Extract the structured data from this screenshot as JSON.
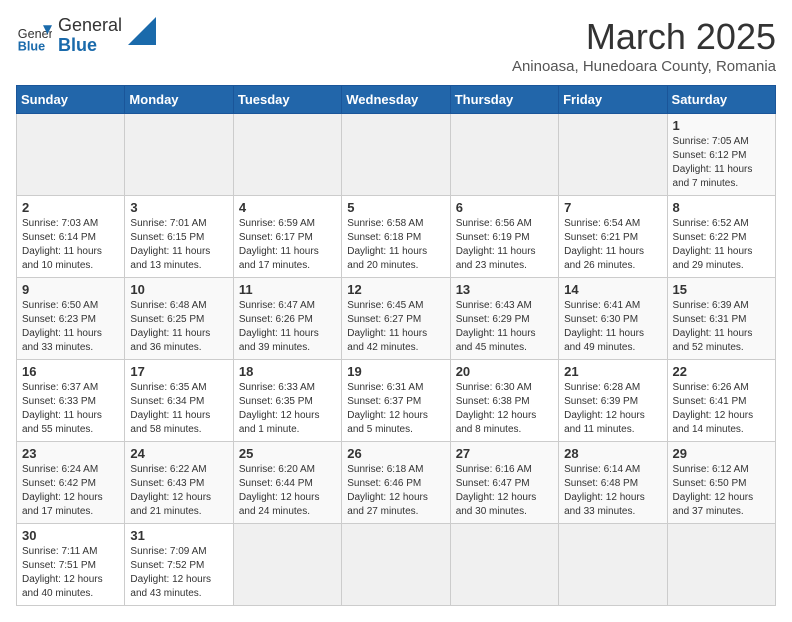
{
  "header": {
    "logo_general": "General",
    "logo_blue": "Blue",
    "month_title": "March 2025",
    "location": "Aninoasa, Hunedoara County, Romania"
  },
  "weekdays": [
    "Sunday",
    "Monday",
    "Tuesday",
    "Wednesday",
    "Thursday",
    "Friday",
    "Saturday"
  ],
  "weeks": [
    [
      {
        "day": "",
        "info": ""
      },
      {
        "day": "",
        "info": ""
      },
      {
        "day": "",
        "info": ""
      },
      {
        "day": "",
        "info": ""
      },
      {
        "day": "",
        "info": ""
      },
      {
        "day": "",
        "info": ""
      },
      {
        "day": "1",
        "info": "Sunrise: 7:05 AM\nSunset: 6:12 PM\nDaylight: 11 hours\nand 7 minutes."
      }
    ],
    [
      {
        "day": "2",
        "info": "Sunrise: 7:03 AM\nSunset: 6:14 PM\nDaylight: 11 hours\nand 10 minutes."
      },
      {
        "day": "3",
        "info": "Sunrise: 7:01 AM\nSunset: 6:15 PM\nDaylight: 11 hours\nand 13 minutes."
      },
      {
        "day": "4",
        "info": "Sunrise: 6:59 AM\nSunset: 6:17 PM\nDaylight: 11 hours\nand 17 minutes."
      },
      {
        "day": "5",
        "info": "Sunrise: 6:58 AM\nSunset: 6:18 PM\nDaylight: 11 hours\nand 20 minutes."
      },
      {
        "day": "6",
        "info": "Sunrise: 6:56 AM\nSunset: 6:19 PM\nDaylight: 11 hours\nand 23 minutes."
      },
      {
        "day": "7",
        "info": "Sunrise: 6:54 AM\nSunset: 6:21 PM\nDaylight: 11 hours\nand 26 minutes."
      },
      {
        "day": "8",
        "info": "Sunrise: 6:52 AM\nSunset: 6:22 PM\nDaylight: 11 hours\nand 29 minutes."
      }
    ],
    [
      {
        "day": "9",
        "info": "Sunrise: 6:50 AM\nSunset: 6:23 PM\nDaylight: 11 hours\nand 33 minutes."
      },
      {
        "day": "10",
        "info": "Sunrise: 6:48 AM\nSunset: 6:25 PM\nDaylight: 11 hours\nand 36 minutes."
      },
      {
        "day": "11",
        "info": "Sunrise: 6:47 AM\nSunset: 6:26 PM\nDaylight: 11 hours\nand 39 minutes."
      },
      {
        "day": "12",
        "info": "Sunrise: 6:45 AM\nSunset: 6:27 PM\nDaylight: 11 hours\nand 42 minutes."
      },
      {
        "day": "13",
        "info": "Sunrise: 6:43 AM\nSunset: 6:29 PM\nDaylight: 11 hours\nand 45 minutes."
      },
      {
        "day": "14",
        "info": "Sunrise: 6:41 AM\nSunset: 6:30 PM\nDaylight: 11 hours\nand 49 minutes."
      },
      {
        "day": "15",
        "info": "Sunrise: 6:39 AM\nSunset: 6:31 PM\nDaylight: 11 hours\nand 52 minutes."
      }
    ],
    [
      {
        "day": "16",
        "info": "Sunrise: 6:37 AM\nSunset: 6:33 PM\nDaylight: 11 hours\nand 55 minutes."
      },
      {
        "day": "17",
        "info": "Sunrise: 6:35 AM\nSunset: 6:34 PM\nDaylight: 11 hours\nand 58 minutes."
      },
      {
        "day": "18",
        "info": "Sunrise: 6:33 AM\nSunset: 6:35 PM\nDaylight: 12 hours\nand 1 minute."
      },
      {
        "day": "19",
        "info": "Sunrise: 6:31 AM\nSunset: 6:37 PM\nDaylight: 12 hours\nand 5 minutes."
      },
      {
        "day": "20",
        "info": "Sunrise: 6:30 AM\nSunset: 6:38 PM\nDaylight: 12 hours\nand 8 minutes."
      },
      {
        "day": "21",
        "info": "Sunrise: 6:28 AM\nSunset: 6:39 PM\nDaylight: 12 hours\nand 11 minutes."
      },
      {
        "day": "22",
        "info": "Sunrise: 6:26 AM\nSunset: 6:41 PM\nDaylight: 12 hours\nand 14 minutes."
      }
    ],
    [
      {
        "day": "23",
        "info": "Sunrise: 6:24 AM\nSunset: 6:42 PM\nDaylight: 12 hours\nand 17 minutes."
      },
      {
        "day": "24",
        "info": "Sunrise: 6:22 AM\nSunset: 6:43 PM\nDaylight: 12 hours\nand 21 minutes."
      },
      {
        "day": "25",
        "info": "Sunrise: 6:20 AM\nSunset: 6:44 PM\nDaylight: 12 hours\nand 24 minutes."
      },
      {
        "day": "26",
        "info": "Sunrise: 6:18 AM\nSunset: 6:46 PM\nDaylight: 12 hours\nand 27 minutes."
      },
      {
        "day": "27",
        "info": "Sunrise: 6:16 AM\nSunset: 6:47 PM\nDaylight: 12 hours\nand 30 minutes."
      },
      {
        "day": "28",
        "info": "Sunrise: 6:14 AM\nSunset: 6:48 PM\nDaylight: 12 hours\nand 33 minutes."
      },
      {
        "day": "29",
        "info": "Sunrise: 6:12 AM\nSunset: 6:50 PM\nDaylight: 12 hours\nand 37 minutes."
      }
    ],
    [
      {
        "day": "30",
        "info": "Sunrise: 7:11 AM\nSunset: 7:51 PM\nDaylight: 12 hours\nand 40 minutes."
      },
      {
        "day": "31",
        "info": "Sunrise: 7:09 AM\nSunset: 7:52 PM\nDaylight: 12 hours\nand 43 minutes."
      },
      {
        "day": "",
        "info": ""
      },
      {
        "day": "",
        "info": ""
      },
      {
        "day": "",
        "info": ""
      },
      {
        "day": "",
        "info": ""
      },
      {
        "day": "",
        "info": ""
      }
    ]
  ]
}
